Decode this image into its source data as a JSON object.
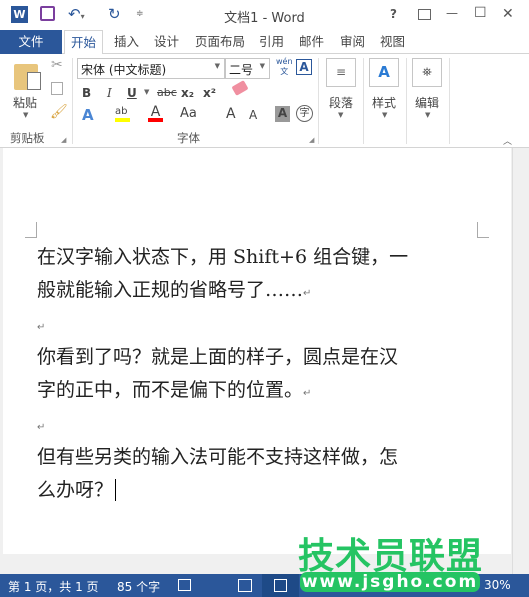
{
  "window": {
    "title": "文档1 - Word",
    "help": "?",
    "minimize": "—",
    "maximize": "☐",
    "close": "✕"
  },
  "quick_access": {
    "word_icon": "W",
    "save": "save-icon",
    "undo": "undo-icon",
    "redo": "redo-icon"
  },
  "tabs": [
    {
      "label": "文件"
    },
    {
      "label": "开始"
    },
    {
      "label": "插入"
    },
    {
      "label": "设计"
    },
    {
      "label": "页面布局"
    },
    {
      "label": "引用"
    },
    {
      "label": "邮件"
    },
    {
      "label": "审阅"
    },
    {
      "label": "视图"
    }
  ],
  "ribbon": {
    "clipboard": {
      "paste": "粘贴",
      "group": "剪贴板"
    },
    "font": {
      "font_name": "宋体 (中文标题)",
      "font_size": "二号",
      "group": "字体",
      "phonetic_top": "wén",
      "phonetic_bottom": "文",
      "bold": "B",
      "italic": "I",
      "underline": "U",
      "strike": "abc",
      "sub": "x₂",
      "sup": "x²",
      "case": "Aa",
      "grow": "A",
      "shrink": "A",
      "char_shade": "A",
      "enclose": "字",
      "highlight_color": "#ffff00",
      "font_color": "#ff0000"
    },
    "paragraph": {
      "label": "段落"
    },
    "styles": {
      "label": "样式"
    },
    "editing": {
      "label": "编辑"
    }
  },
  "document": {
    "lines": [
      "在汉字输入状态下，用 Shift+6 组合键，一",
      "般就能输入正规的省略号了……",
      "",
      "你看到了吗？就是上面的样子，圆点是在汉",
      "字的正中，而不是偏下的位置。",
      "",
      "但有些另类的输入法可能不支持这样做，怎",
      "么办呀？"
    ],
    "para_mark": "↵"
  },
  "status": {
    "page": "第 1 页，共 1 页",
    "words": "85 个字",
    "zoom": "30%"
  },
  "watermark": {
    "text": "技术员联盟",
    "url": "www.jsgho.com"
  }
}
